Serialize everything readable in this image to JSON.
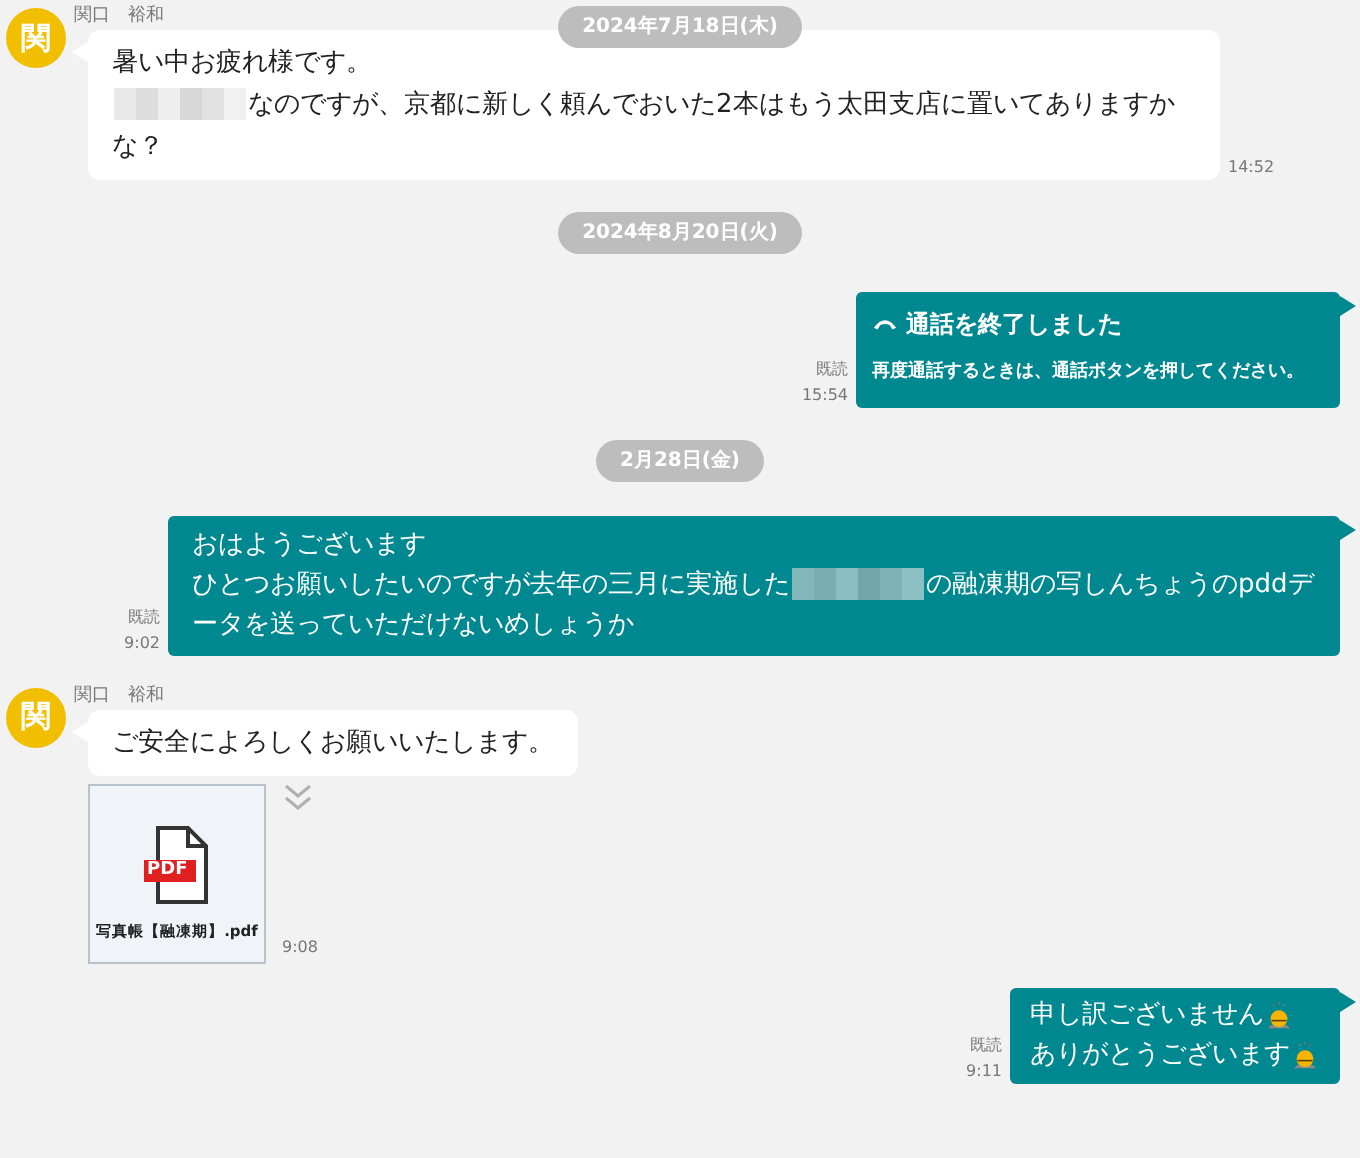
{
  "sticky_date": "2024年7月18日(木)",
  "items": [
    {
      "kind": "incoming",
      "avatar": "関",
      "sender": "関口　裕和",
      "lines": [
        [
          {
            "text": "暑い中お疲れ様です。"
          }
        ],
        [
          {
            "kind": "redaction"
          },
          {
            "text": "なのですが、京都に新しく頼んでおいた2本はもう太田支店に置いてありますかな？"
          }
        ]
      ],
      "time": "14:52"
    },
    {
      "kind": "date",
      "label": "2024年8月20日(火)"
    },
    {
      "kind": "call",
      "title": "通話を終了しました",
      "note": "再度通話するときは、通話ボタンを押してください。",
      "read": "既読",
      "time": "15:54"
    },
    {
      "kind": "date",
      "label": "2月28日(金)"
    },
    {
      "kind": "outgoing",
      "lines": [
        [
          {
            "text": "おはようございます"
          }
        ],
        [
          {
            "text": "ひとつお願いしたいのですが去年の三月に実施した"
          },
          {
            "kind": "redaction"
          },
          {
            "text": "の融凍期の写しんちょうのpddデータを送っていただけないめしょうか"
          }
        ]
      ],
      "read": "既読",
      "time": "9:02"
    },
    {
      "kind": "incoming",
      "avatar": "関",
      "sender": "関口　裕和",
      "lines": [
        [
          {
            "text": "ご安全によろしくお願いいたします。"
          }
        ]
      ]
    },
    {
      "kind": "file",
      "filename": "写真帳【融凍期】.pdf",
      "badge": "PDF",
      "time": "9:08"
    },
    {
      "kind": "outgoing_emoji",
      "lines": [
        {
          "text": "申し訳ございません",
          "kind": "with_emoji"
        },
        {
          "text": "ありがとうございます",
          "kind": "with_emoji"
        }
      ],
      "read": "既読",
      "time": "9:11"
    }
  ]
}
